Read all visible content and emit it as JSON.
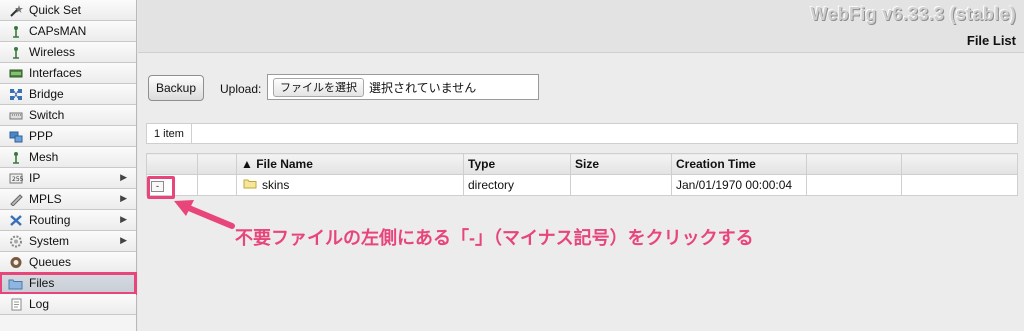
{
  "app": {
    "title": "WebFig v6.33.3 (stable)",
    "page_title": "File List"
  },
  "sidebar": {
    "items": [
      {
        "label": "Quick Set",
        "icon": "wand-icon",
        "submenu": false
      },
      {
        "label": "CAPsMAN",
        "icon": "antenna-icon",
        "submenu": false
      },
      {
        "label": "Wireless",
        "icon": "wireless-icon",
        "submenu": false
      },
      {
        "label": "Interfaces",
        "icon": "interfaces-icon",
        "submenu": false
      },
      {
        "label": "Bridge",
        "icon": "bridge-icon",
        "submenu": false
      },
      {
        "label": "Switch",
        "icon": "switch-icon",
        "submenu": false
      },
      {
        "label": "PPP",
        "icon": "ppp-icon",
        "submenu": false
      },
      {
        "label": "Mesh",
        "icon": "mesh-icon",
        "submenu": false
      },
      {
        "label": "IP",
        "icon": "ip-icon",
        "submenu": true
      },
      {
        "label": "MPLS",
        "icon": "mpls-icon",
        "submenu": true
      },
      {
        "label": "Routing",
        "icon": "routing-icon",
        "submenu": true
      },
      {
        "label": "System",
        "icon": "gear-icon",
        "submenu": true
      },
      {
        "label": "Queues",
        "icon": "queues-icon",
        "submenu": false
      },
      {
        "label": "Files",
        "icon": "folder-icon",
        "submenu": false,
        "selected": true
      },
      {
        "label": "Log",
        "icon": "log-icon",
        "submenu": false
      }
    ]
  },
  "toolbar": {
    "backup_label": "Backup",
    "upload_label": "Upload:",
    "choose_file_label": "ファイルを選択",
    "no_file_text": "選択されていません"
  },
  "list": {
    "item_count": "1 item",
    "columns": {
      "name": "▲ File Name",
      "type": "Type",
      "size": "Size",
      "created": "Creation Time"
    },
    "rows": [
      {
        "remove": "-",
        "name": "skins",
        "type": "directory",
        "size": "",
        "created": "Jan/01/1970 00:00:04"
      }
    ]
  },
  "annotation": {
    "text": "不要ファイルの左側にある「-」（マイナス記号）をクリックする",
    "color": "#e8457a"
  }
}
